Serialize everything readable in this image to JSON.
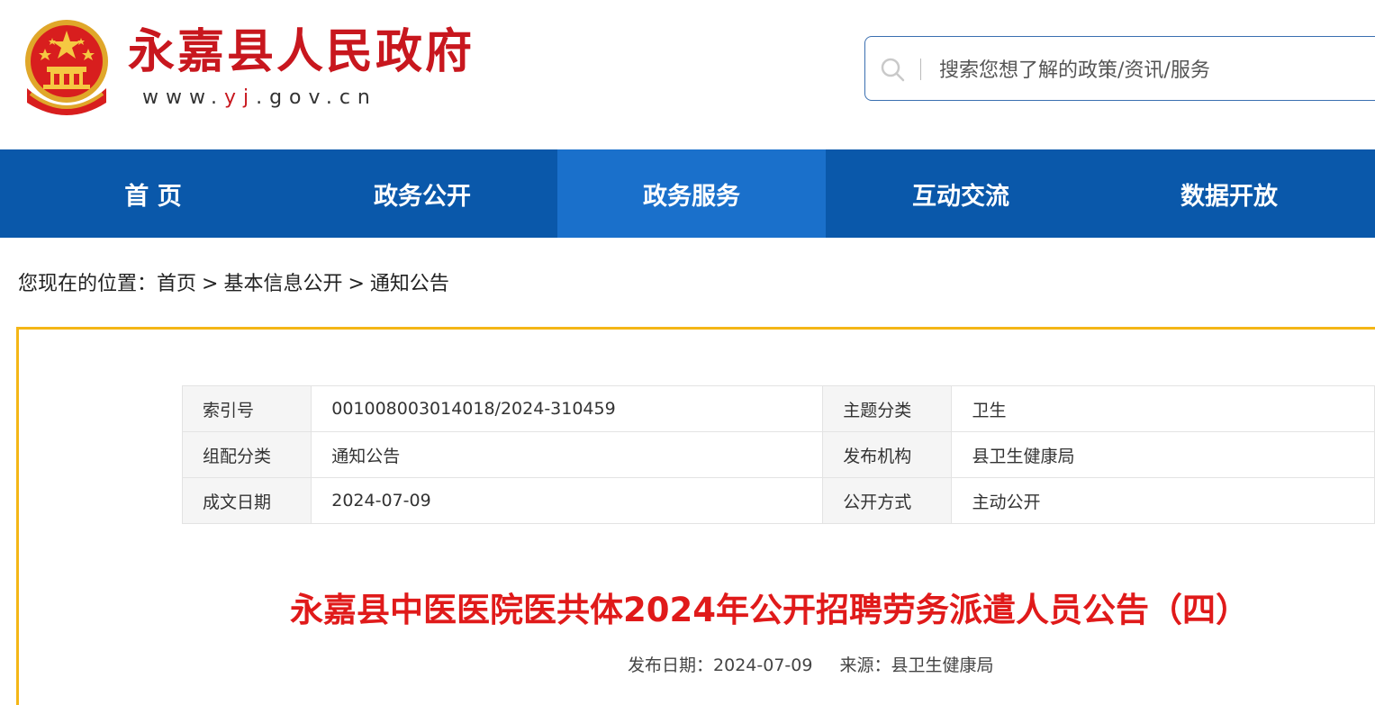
{
  "header": {
    "site_name": "永嘉县人民政府",
    "url_prefix": "www.",
    "url_accent": "yj",
    "url_suffix": ".gov.cn",
    "search_placeholder": "搜索您想了解的政策/资讯/服务"
  },
  "nav": {
    "items": [
      {
        "label": "首 页"
      },
      {
        "label": "政务公开"
      },
      {
        "label": "政务服务"
      },
      {
        "label": "互动交流"
      },
      {
        "label": "数据开放"
      }
    ],
    "active_index": 2
  },
  "breadcrumb": {
    "prefix": "您现在的位置：",
    "items": [
      "首页",
      "基本信息公开",
      "通知公告"
    ],
    "separator": ">"
  },
  "meta": {
    "rows": [
      {
        "label1": "索引号",
        "value1": "001008003014018/2024-310459",
        "label2": "主题分类",
        "value2": "卫生"
      },
      {
        "label1": "组配分类",
        "value1": "通知公告",
        "label2": "发布机构",
        "value2": "县卫生健康局"
      },
      {
        "label1": "成文日期",
        "value1": "2024-07-09",
        "label2": "公开方式",
        "value2": "主动公开"
      }
    ]
  },
  "article": {
    "title": "永嘉县中医医院医共体2024年公开招聘劳务派遣人员公告（四）",
    "publish_label": "发布日期：",
    "publish_date": "2024-07-09",
    "source_label": "来源：",
    "source": "县卫生健康局"
  },
  "colors": {
    "brand_red": "#c8171e",
    "nav_blue": "#0a58aa",
    "nav_active": "#1a70cb",
    "panel_border": "#f4b616",
    "title_red": "#e01a1a"
  }
}
